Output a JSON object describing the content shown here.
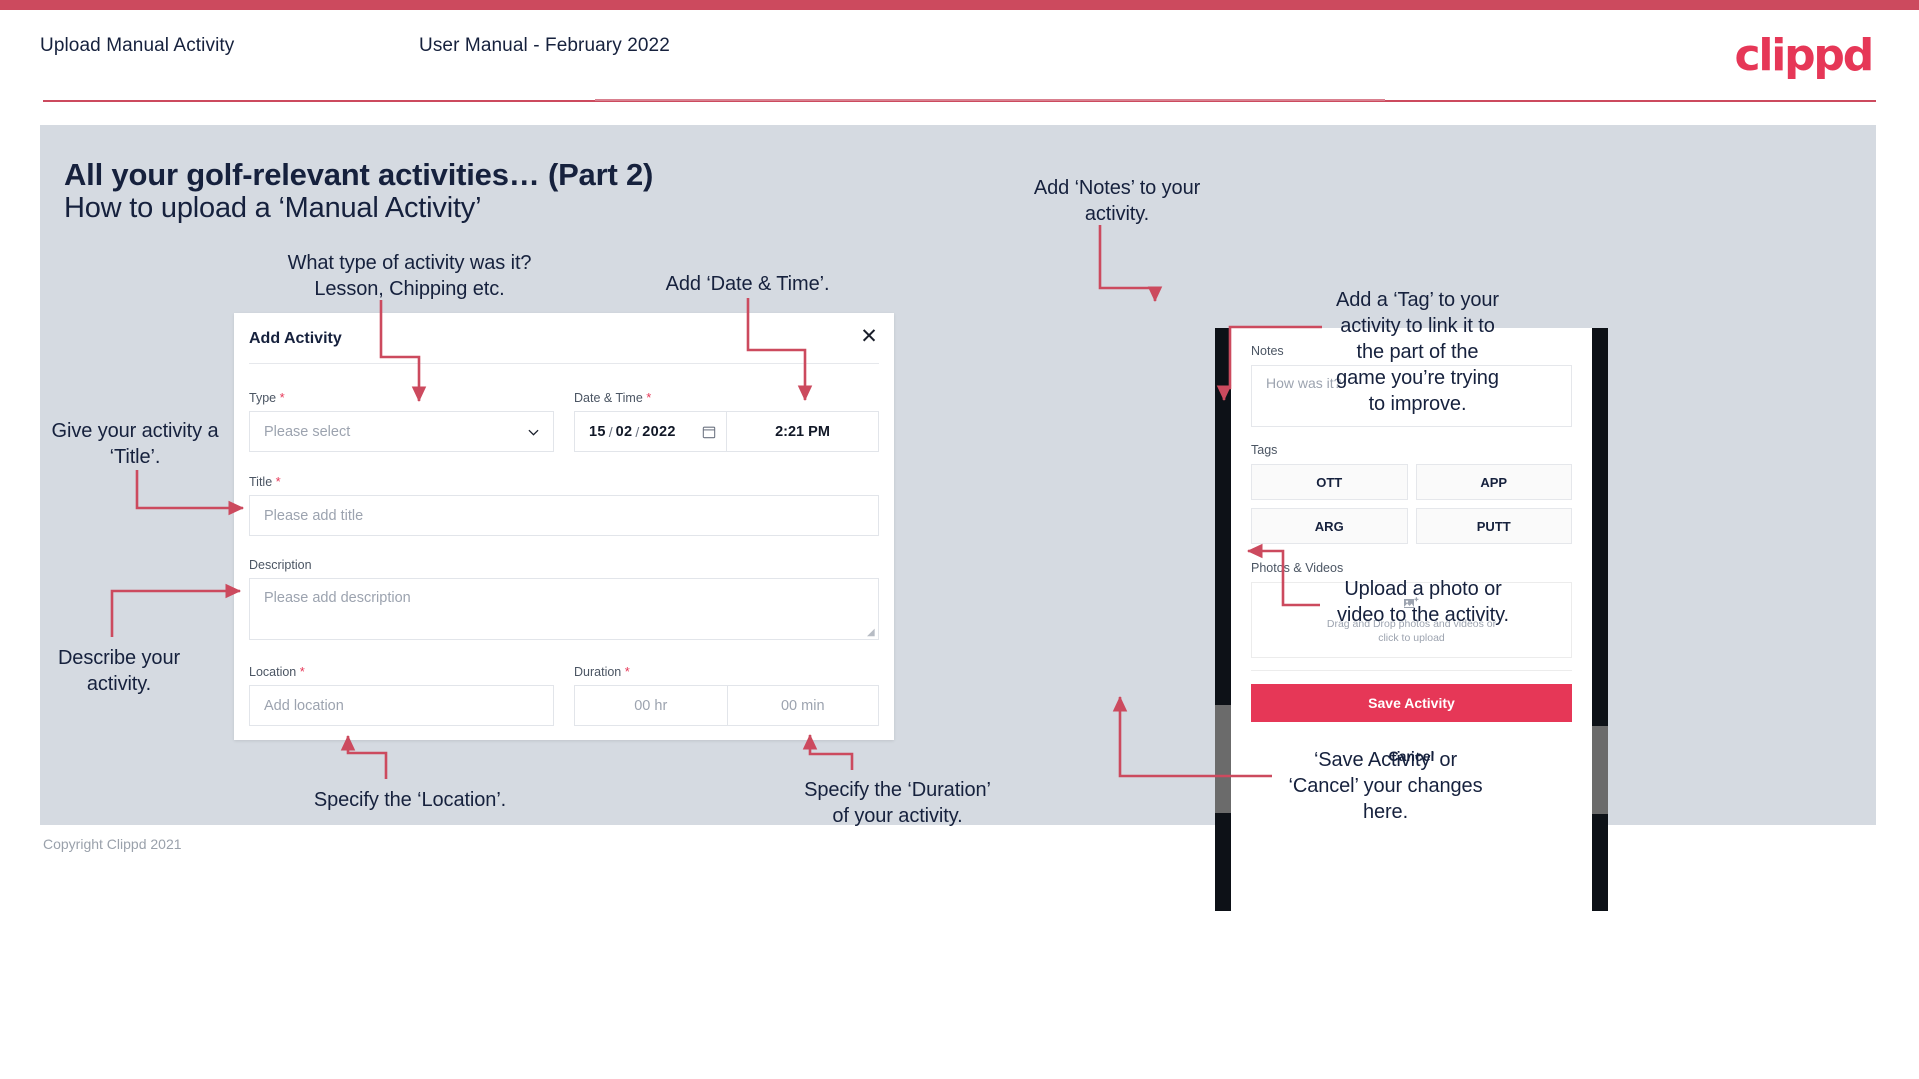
{
  "header": {
    "title": "Upload Manual Activity",
    "subtitle": "User Manual - February 2022",
    "logo": "clippd"
  },
  "slide": {
    "title": "All your golf-relevant activities… (Part 2)",
    "subtitle": "How to upload a ‘Manual Activity’",
    "copyright": "Copyright Clippd 2021"
  },
  "dialog": {
    "title": "Add Activity",
    "close_icon": "close-icon",
    "fields": {
      "type": {
        "label": "Type",
        "required": "*",
        "placeholder": "Please select"
      },
      "datetime": {
        "label": "Date & Time",
        "required": "*",
        "day": "15",
        "month": "02",
        "year": "2022",
        "sep": "/",
        "time": "2:21 PM"
      },
      "title": {
        "label": "Title",
        "required": "*",
        "placeholder": "Please add title"
      },
      "description": {
        "label": "Description",
        "placeholder": "Please add description"
      },
      "location": {
        "label": "Location",
        "required": "*",
        "placeholder": "Add location"
      },
      "duration": {
        "label": "Duration",
        "required": "*",
        "hours": "00 hr",
        "minutes": "00 min"
      }
    }
  },
  "phone": {
    "notes": {
      "label": "Notes",
      "placeholder": "How was it?"
    },
    "tags": {
      "label": "Tags",
      "items": [
        "OTT",
        "APP",
        "ARG",
        "PUTT"
      ]
    },
    "photos": {
      "label": "Photos & Videos",
      "upload_line1": "Drag and Drop photos and videos or",
      "upload_line2": "click to upload",
      "icon": "add-image-icon"
    },
    "save_label": "Save Activity",
    "cancel_label": "Cancel"
  },
  "annotations": {
    "type": "What type of activity was it?\nLesson, Chipping etc.",
    "datetime": "Add ‘Date & Time’.",
    "title": "Give your activity a\n‘Title’.",
    "description": "Describe your\nactivity.",
    "location": "Specify the ‘Location’.",
    "duration": "Specify the ‘Duration’\nof your activity.",
    "notes": "Add ‘Notes’ to your\nactivity.",
    "tags": "Add a ‘Tag’ to your\nactivity to link it to\nthe part of the\ngame you’re trying\nto improve.",
    "upload": "Upload a photo or\nvideo to the activity.",
    "save": "‘Save Activity’ or\n‘Cancel’ your changes\nhere."
  },
  "colors": {
    "accent": "#e63757",
    "topbar": "#cc4a5e",
    "slide_bg": "#d5dae1",
    "text": "#16213d",
    "arrow": "#cc4a5e"
  }
}
